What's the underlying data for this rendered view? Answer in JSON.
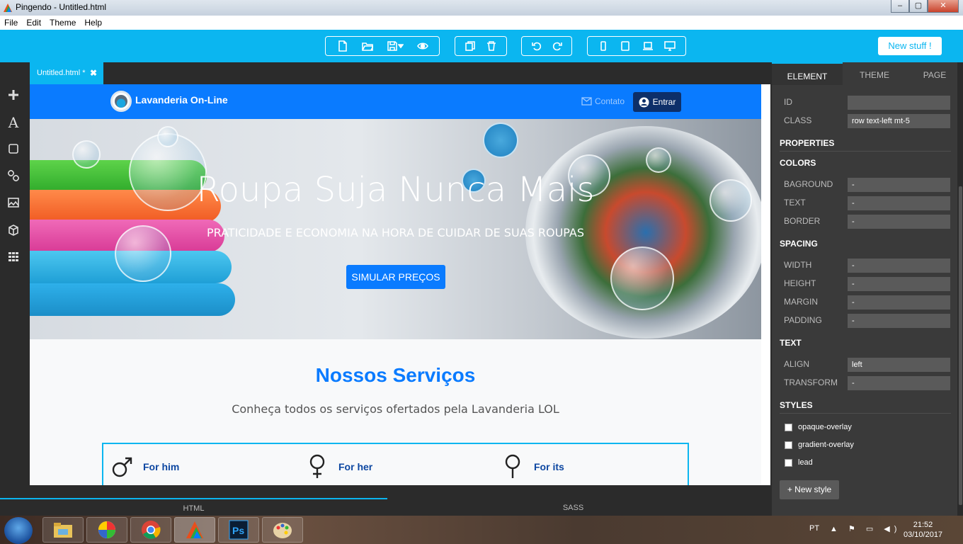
{
  "window": {
    "title": "Pingendo - Untitled.html",
    "btn_min": "–",
    "btn_max": "▢",
    "btn_close": "✕"
  },
  "menu": [
    "File",
    "Edit",
    "Theme",
    "Help"
  ],
  "toolbar": {
    "new_stuff": "New stuff !"
  },
  "tab": {
    "name": "Untitled.html *",
    "close": "✖"
  },
  "site": {
    "brand": "Lavanderia On-Line",
    "contato": "Contato",
    "entrar": "Entrar",
    "hero_title": "Roupa Suja Nunca Mais",
    "hero_subtitle": "PRATICIDADE E ECONOMIA NA HORA DE CUIDAR DE SUAS ROUPAS",
    "hero_button": "SIMULAR PREÇOS",
    "services_title": "Nossos Serviços",
    "services_subtitle": "Conheça todos os serviços ofertados pela Lavanderia LOL",
    "services": [
      "For him",
      "For her",
      "For its"
    ]
  },
  "panel": {
    "tabs": [
      "ELEMENT",
      "THEME",
      "PAGE"
    ],
    "id_label": "ID",
    "id_value": "",
    "class_label": "CLASS",
    "class_value": "row text-left mt-5",
    "properties": "PROPERTIES",
    "colors": "COLORS",
    "bground_label": "BAGROUND",
    "bground_value": "-",
    "text_label": "TEXT",
    "text_value": "-",
    "border_label": "BORDER",
    "border_value": "-",
    "spacing": "SPACING",
    "width_label": "WIDTH",
    "width_value": "-",
    "height_label": "HEIGHT",
    "height_value": "-",
    "margin_label": "MARGIN",
    "margin_value": "-",
    "padding_label": "PADDING",
    "padding_value": "-",
    "text_section": "TEXT",
    "align_label": "ALIGN",
    "align_value": "left",
    "transform_label": "TRANSFORM",
    "transform_value": "-",
    "styles": "STYLES",
    "style_options": [
      "opaque-overlay",
      "gradient-overlay",
      "lead"
    ],
    "new_style": "+ New style"
  },
  "bottom_tabs": [
    "HTML",
    "SASS"
  ],
  "taskbar": {
    "lang": "PT",
    "tray": "▲ ⚑ ▭ ◀)",
    "time": "21:52",
    "date": "03/10/2017"
  },
  "colors": {
    "accent": "#0bb6f0",
    "site_primary": "#0a7bff",
    "panel_bg": "#3a3a3a"
  }
}
